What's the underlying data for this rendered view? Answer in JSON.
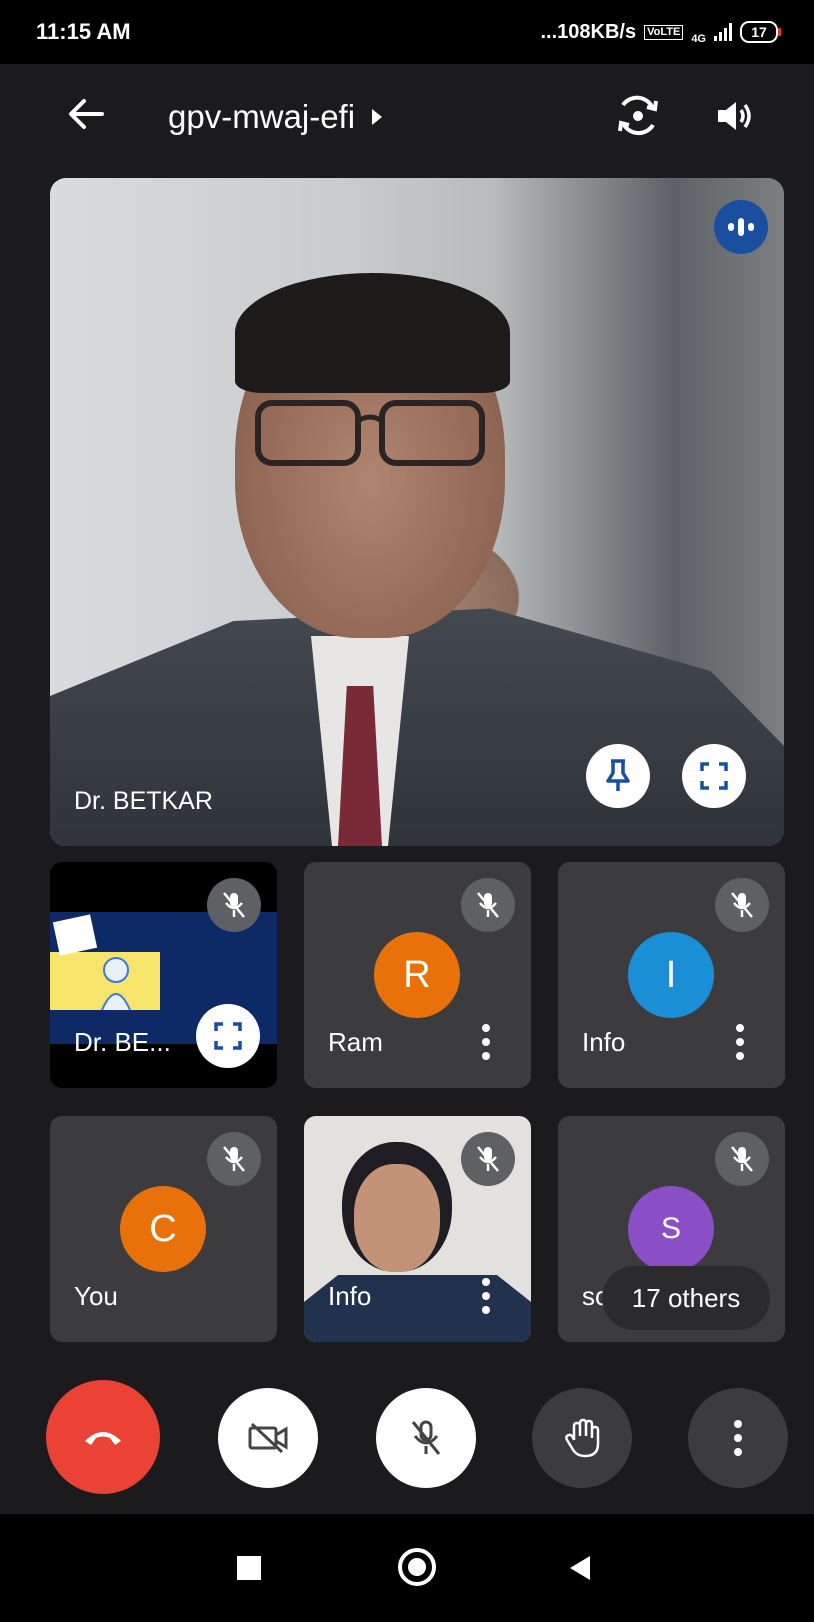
{
  "status": {
    "time": "11:15 AM",
    "speed": "...108KB/s",
    "volte": "VO LTE",
    "network": "4G",
    "battery": "17"
  },
  "header": {
    "meeting_code": "gpv-mwaj-efi"
  },
  "main_tile": {
    "name": "Dr. BETKAR"
  },
  "tiles": [
    {
      "name": "Dr. BE...",
      "muted": true
    },
    {
      "name": "Ram",
      "avatar_letter": "R",
      "avatar_color": "#e8710a",
      "muted": true
    },
    {
      "name": "Info",
      "avatar_letter": "I",
      "avatar_color": "#1a8fd6",
      "muted": true
    },
    {
      "name": "You",
      "avatar_letter": "C",
      "avatar_color": "#e8710a",
      "muted": true
    },
    {
      "name": "Info",
      "muted": true
    },
    {
      "name": "so",
      "avatar_letter": "S",
      "avatar_color": "#8a4fc6",
      "muted": true
    }
  ],
  "others_label": "17 others",
  "colors": {
    "end_call": "#ea4335",
    "tile_bg": "#3c3c3f",
    "mute_badge": "#5f6064"
  }
}
